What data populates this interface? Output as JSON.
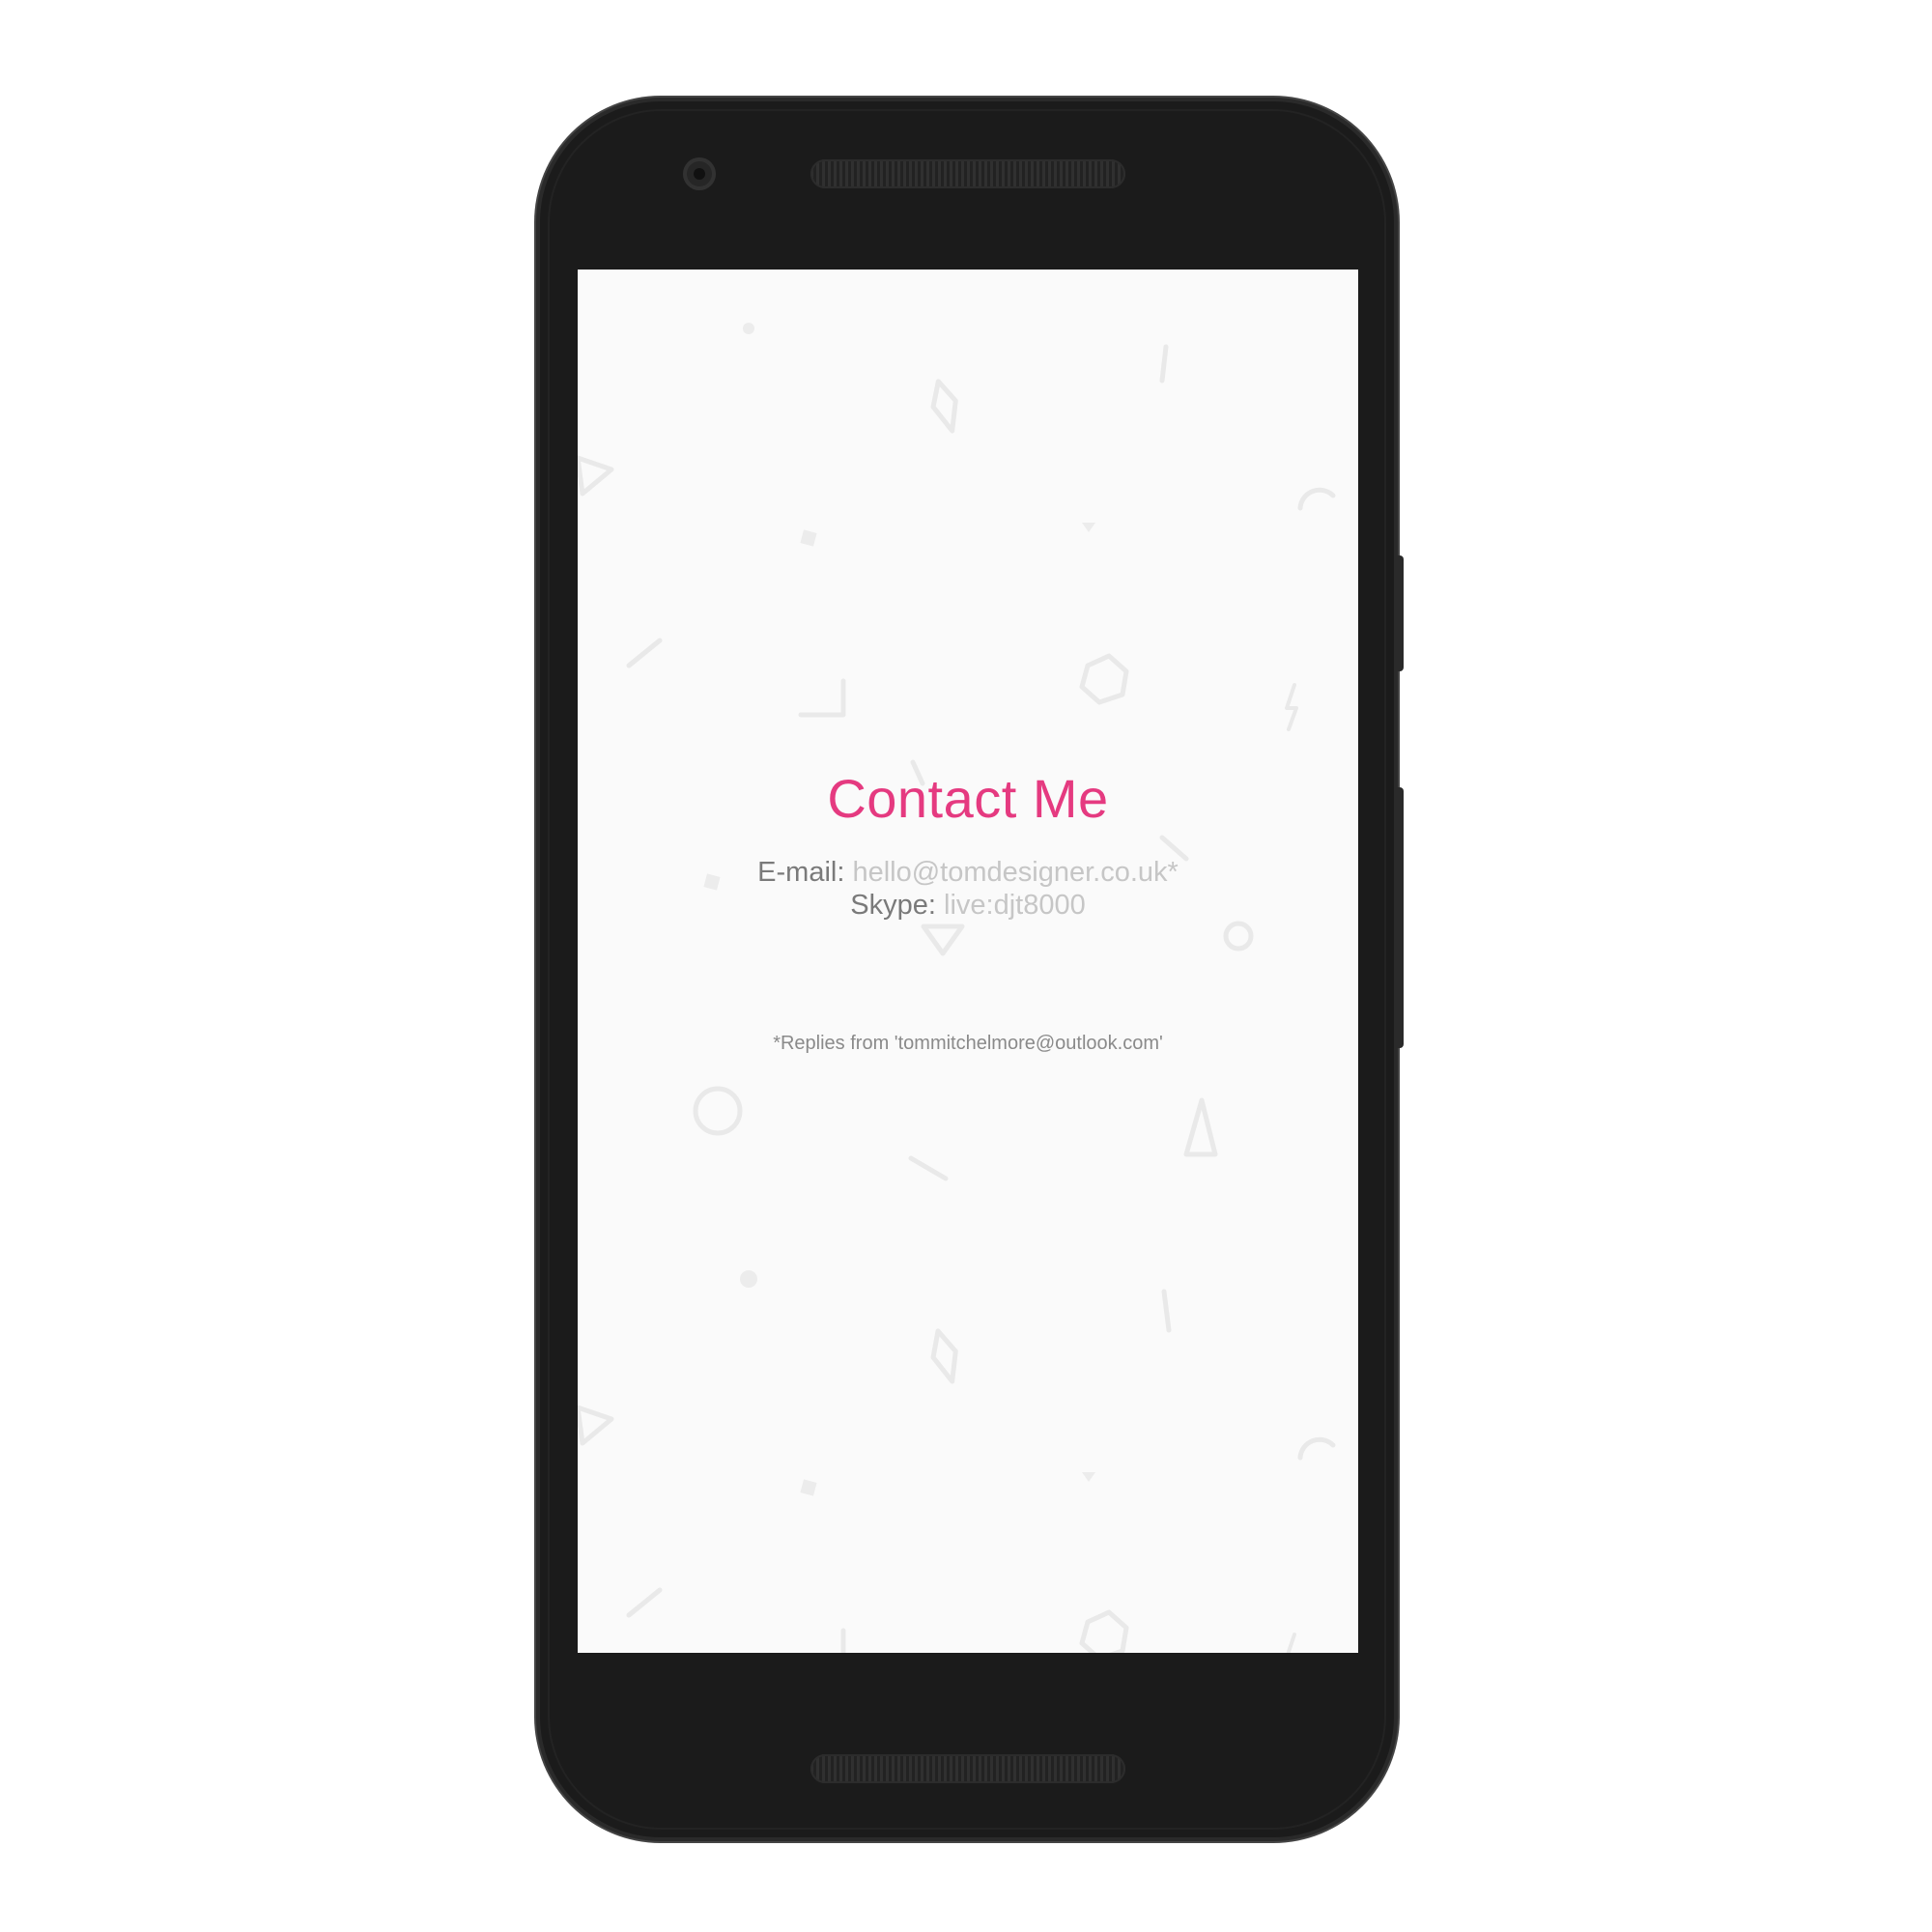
{
  "page": {
    "title": "Contact Me",
    "email_label": "E-mail:",
    "email_value": "hello@tomdesigner.co.uk*",
    "skype_label": "Skype:",
    "skype_value": "live:djt8000",
    "note": "*Replies from 'tommitchelmore@outlook.com'"
  },
  "colors": {
    "accent": "#e53a80",
    "screen_background": "#fafafa",
    "device_body": "#1b1b1b"
  }
}
